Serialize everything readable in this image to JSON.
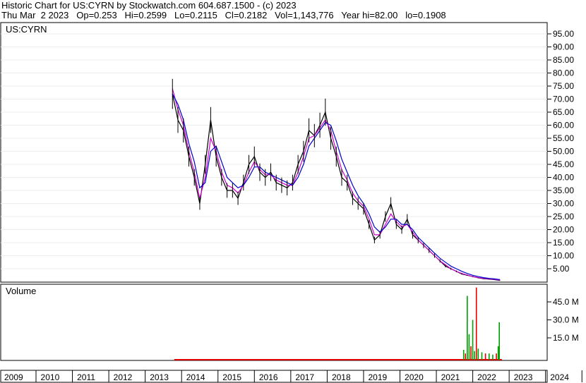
{
  "header": {
    "line1": "Historic Chart for US:CYRN by Stockwatch.com 604.687.1500 - (c) 2023",
    "line2": "Thu Mar  2 2023   Op=0.253   Hi=0.2599   Lo=0.2115   Cl=0.2182   Vol=1,143,776   Year hi=82.00   lo=0.1908"
  },
  "chart_data": [
    {
      "type": "line",
      "title": "US:CYRN",
      "y_ticks": [
        "95.00",
        "90.00",
        "85.00",
        "80.00",
        "75.00",
        "70.00",
        "65.00",
        "60.00",
        "55.00",
        "50.00",
        "45.00",
        "40.00",
        "35.00",
        "30.00",
        "25.00",
        "20.00",
        "15.00",
        "10.00",
        "5.00"
      ],
      "ylim": [
        0,
        100
      ],
      "x": [
        2013.7,
        2013.85,
        2014.0,
        2014.15,
        2014.3,
        2014.45,
        2014.6,
        2014.75,
        2014.9,
        2015.05,
        2015.2,
        2015.35,
        2015.5,
        2015.65,
        2015.8,
        2015.95,
        2016.1,
        2016.25,
        2016.4,
        2016.55,
        2016.7,
        2016.85,
        2017.0,
        2017.15,
        2017.3,
        2017.45,
        2017.6,
        2017.75,
        2017.9,
        2018.05,
        2018.2,
        2018.35,
        2018.5,
        2018.65,
        2018.8,
        2018.95,
        2019.1,
        2019.25,
        2019.4,
        2019.55,
        2019.7,
        2019.85,
        2020.0,
        2020.15,
        2020.3,
        2020.45,
        2020.6,
        2020.75,
        2020.9,
        2021.05,
        2021.2,
        2021.35,
        2021.5,
        2021.65,
        2021.8,
        2021.95,
        2022.1,
        2022.25,
        2022.4,
        2022.55,
        2022.7
      ],
      "series": [
        {
          "values": [
            72,
            62,
            58,
            48,
            40,
            30,
            45,
            62,
            48,
            40,
            35,
            35,
            32,
            38,
            45,
            48,
            42,
            40,
            42,
            38,
            37,
            36,
            38,
            45,
            50,
            58,
            56,
            60,
            65,
            55,
            48,
            40,
            38,
            32,
            30,
            28,
            22,
            16,
            18,
            25,
            30,
            22,
            20,
            24,
            18,
            16,
            14,
            12,
            10,
            8,
            6,
            5,
            4,
            3,
            2.5,
            2,
            1.5,
            1.2,
            1.0,
            0.8,
            0.5
          ]
        },
        {
          "values": [
            74,
            66,
            60,
            50,
            42,
            32,
            40,
            55,
            50,
            42,
            37,
            36,
            34,
            37,
            42,
            46,
            43,
            41,
            41,
            39,
            38,
            37,
            37,
            42,
            48,
            55,
            56,
            59,
            62,
            58,
            50,
            43,
            39,
            34,
            31,
            29,
            24,
            18,
            18,
            22,
            26,
            23,
            21,
            22,
            19,
            16,
            14,
            12,
            10,
            8,
            6.5,
            5,
            4,
            3.2,
            2.6,
            2,
            1.6,
            1.3,
            1.1,
            0.9,
            0.6
          ]
        },
        {
          "values": [
            72,
            68,
            62,
            53,
            46,
            36,
            38,
            50,
            52,
            46,
            40,
            38,
            36,
            37,
            40,
            44,
            44,
            42,
            41,
            40,
            39,
            38,
            37,
            40,
            45,
            52,
            55,
            58,
            61,
            60,
            54,
            47,
            42,
            37,
            33,
            30,
            26,
            21,
            19,
            21,
            24,
            24,
            22,
            22,
            20,
            17,
            15,
            13,
            11,
            9,
            7.5,
            6,
            5,
            4,
            3.2,
            2.5,
            2,
            1.6,
            1.3,
            1.1,
            0.8
          ]
        }
      ]
    },
    {
      "type": "bar",
      "title": "Volume",
      "y_ticks": [
        "45.0 M",
        "30.0 M",
        "15.0 M"
      ],
      "ylim": [
        0,
        60
      ],
      "x": [
        2021.7,
        2021.75,
        2021.8,
        2021.85,
        2021.9,
        2021.95,
        2022.0,
        2022.05,
        2022.1,
        2022.2,
        2022.3,
        2022.4,
        2022.5,
        2022.6,
        2022.65,
        2022.68
      ],
      "values": [
        5,
        2,
        50,
        18,
        8,
        30,
        4,
        57,
        6,
        3,
        2,
        2,
        1,
        2,
        8,
        28
      ]
    }
  ],
  "x_axis": {
    "ticks": [
      "2009",
      "2010",
      "2011",
      "2012",
      "2013",
      "2014",
      "2015",
      "2016",
      "2017",
      "2018",
      "2019",
      "2020",
      "2021",
      "2022",
      "2023",
      "2024"
    ]
  },
  "colors": {
    "price": "#000000",
    "ma_fast": "#d000d0",
    "ma_slow": "#0000cc",
    "volume_up": "#00a000",
    "volume_down": "#e00000",
    "gridline": "#b0b0b0",
    "candle_down": "#ff0000"
  }
}
